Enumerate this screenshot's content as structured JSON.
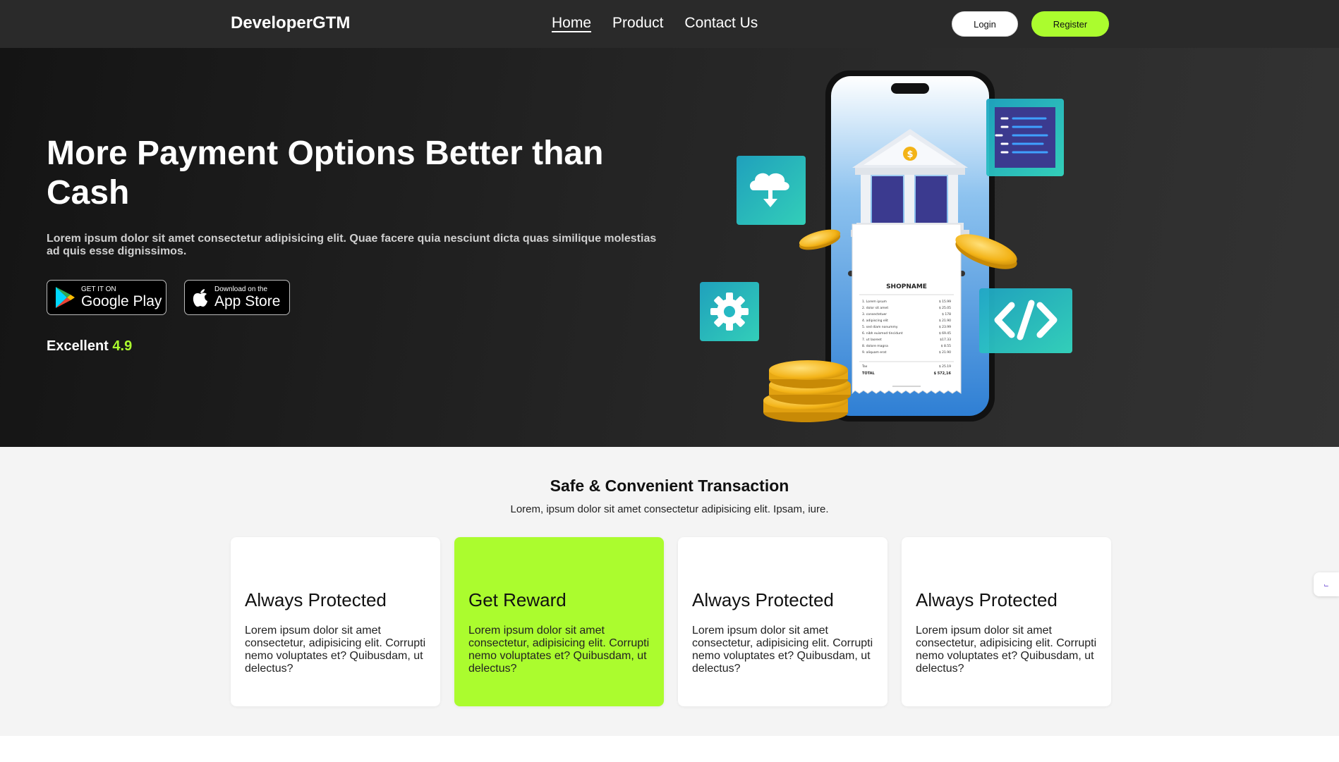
{
  "nav": {
    "brand": "DeveloperGTM",
    "links": [
      {
        "label": "Home",
        "active": true
      },
      {
        "label": "Product",
        "active": false
      },
      {
        "label": "Contact Us",
        "active": false
      }
    ],
    "login_label": "Login",
    "register_label": "Register"
  },
  "hero": {
    "title": "More Payment Options Better than Cash",
    "description": "Lorem ipsum dolor sit amet consectetur adipisicing elit. Quae facere quia nesciunt dicta quas similique molestias ad quis esse dignissimos.",
    "google_play": {
      "small": "GET IT ON",
      "big": "Google Play"
    },
    "app_store": {
      "small": "Download on the",
      "big": "App Store"
    },
    "rating_label": "Excellent",
    "rating_value": "4.9"
  },
  "receipt": {
    "shop": "SHOPNAME",
    "items": [
      {
        "name": "1. Lorem ipsum",
        "price": "$ 15.99"
      },
      {
        "name": "2. dolor sit amet",
        "price": "$ 25.05"
      },
      {
        "name": "3. consectetuer",
        "price": "$ 178"
      },
      {
        "name": "4. adipiscing elit",
        "price": "$ 21.90"
      },
      {
        "name": "5. sed diam nonummy",
        "price": "$ 23.99"
      },
      {
        "name": "6. nibh euismod tincidunt",
        "price": "$ 69.45"
      },
      {
        "name": "7. ut laoreet",
        "price": "$17.33"
      },
      {
        "name": "8. dolore magna",
        "price": "$ 8.55"
      },
      {
        "name": "9. aliquam erat",
        "price": "$ 21.90"
      }
    ],
    "tax_label": "Tax",
    "tax_value": "$ 25.19",
    "total_label": "TOTAL",
    "total_value": "$ 572,16",
    "bank_symbol": "$"
  },
  "features": {
    "title": "Safe & Convenient Transaction",
    "subtitle": "Lorem, ipsum dolor sit amet consectetur adipisicing elit. Ipsam, iure.",
    "cards": [
      {
        "title": "Always Protected",
        "text": "Lorem ipsum dolor sit amet consectetur, adipisicing elit. Corrupti nemo voluptates et? Quibusdam, ut delectus?",
        "highlight": false
      },
      {
        "title": "Get Reward",
        "text": "Lorem ipsum dolor sit amet consectetur, adipisicing elit. Corrupti nemo voluptates et? Quibusdam, ut delectus?",
        "highlight": true
      },
      {
        "title": "Always Protected",
        "text": "Lorem ipsum dolor sit amet consectetur, adipisicing elit. Corrupti nemo voluptates et? Quibusdam, ut delectus?",
        "highlight": false
      },
      {
        "title": "Always Protected",
        "text": "Lorem ipsum dolor sit amet consectetur, adipisicing elit. Corrupti nemo voluptates et? Quibusdam, ut delectus?",
        "highlight": false
      }
    ]
  },
  "colors": {
    "accent": "#abfc2e",
    "nav_bg": "#2a2a2a",
    "teal": "#2cc9c0",
    "navy": "#3b3a8f"
  }
}
